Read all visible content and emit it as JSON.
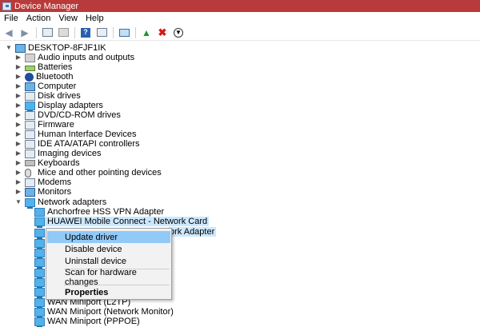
{
  "window": {
    "title": "Device Manager"
  },
  "menu": [
    "File",
    "Action",
    "View",
    "Help"
  ],
  "toolbar": {
    "buttons": [
      "back-icon",
      "forward-icon",
      "properties-icon",
      "show-hidden-icon",
      "help-icon",
      "scan-hardware-icon",
      "add-driver-icon",
      "uninstall-icon",
      "update-driver-icon"
    ]
  },
  "tree": {
    "root": "DESKTOP-8FJF1IK",
    "categories": [
      "Audio inputs and outputs",
      "Batteries",
      "Bluetooth",
      "Computer",
      "Disk drives",
      "Display adapters",
      "DVD/CD-ROM drives",
      "Firmware",
      "Human Interface Devices",
      "IDE ATA/ATAPI controllers",
      "Imaging devices",
      "Keyboards",
      "Mice and other pointing devices",
      "Modems",
      "Monitors",
      "Network adapters"
    ],
    "network_children": [
      "Anchorfree HSS VPN Adapter",
      "HUAWEI Mobile Connect - Network Card",
      "ork Adapter",
      "WAN Miniport (L2TP)",
      "WAN Miniport (Network Monitor)",
      "WAN Miniport (PPPOE)"
    ]
  },
  "context_menu": {
    "items": [
      "Update driver",
      "Disable device",
      "Uninstall device",
      "Scan for hardware changes",
      "Properties"
    ],
    "hovered": "Update driver"
  },
  "colors": {
    "titlebar": "#b93a3a",
    "selection": "#cce8ff",
    "menu_hover": "#91c9f7"
  }
}
